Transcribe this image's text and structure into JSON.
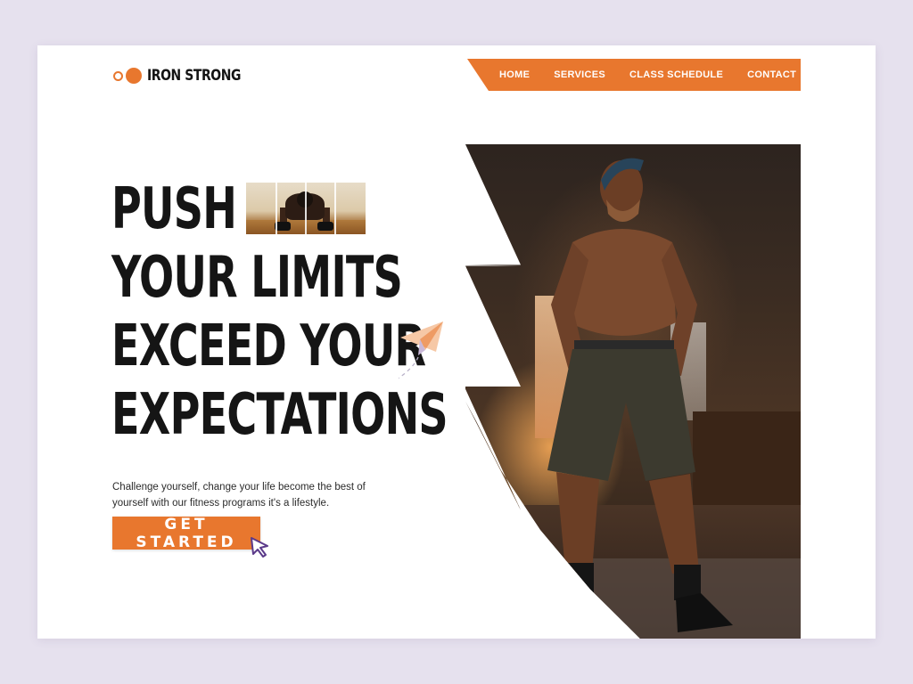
{
  "brand": {
    "name": "IRON STRONG",
    "accent": "#e8772e"
  },
  "nav": {
    "items": [
      {
        "label": "HOME"
      },
      {
        "label": "SERVICES"
      },
      {
        "label": "CLASS SCHEDULE"
      },
      {
        "label": "CONTACT"
      }
    ]
  },
  "hero": {
    "headline": [
      "PUSH",
      "YOUR LIMITS",
      "EXCEED YOUR",
      "EXPECTATIONS"
    ],
    "subtitle": "Challenge yourself, change your life become the best of yourself with our fitness programs it's a lifestyle.",
    "cta_label": "GET STARTED"
  },
  "icons": {
    "paper_plane": "paper-plane-icon",
    "cursor": "cursor-pointer-icon"
  }
}
